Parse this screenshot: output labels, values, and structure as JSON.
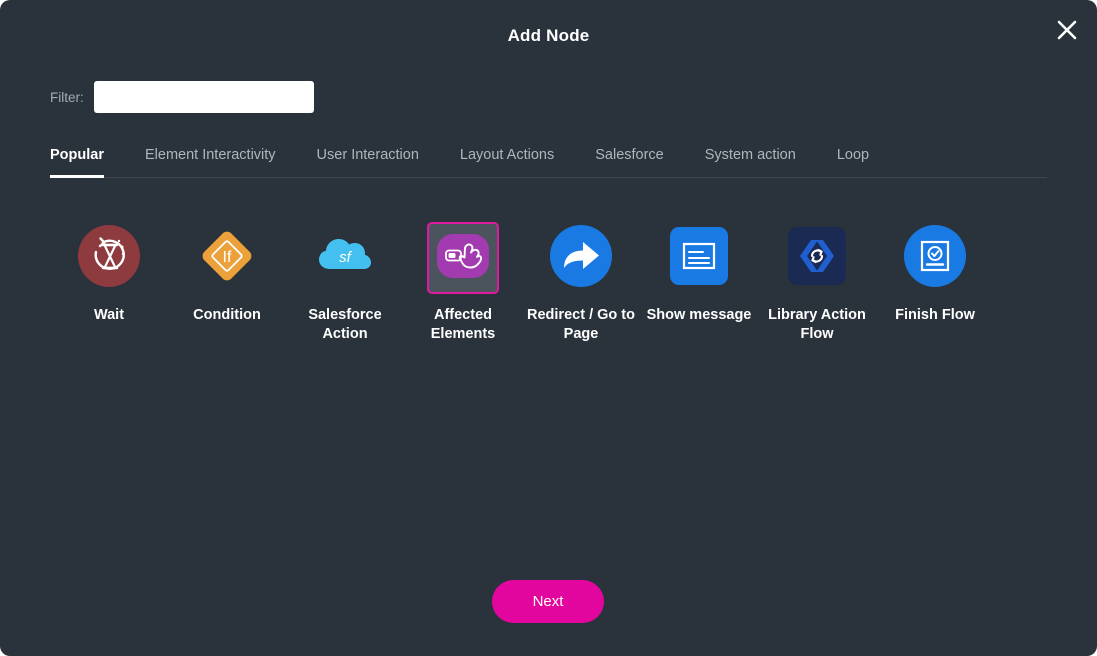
{
  "dialog": {
    "title": "Add Node",
    "close_icon": "close-icon"
  },
  "filter": {
    "label": "Filter:",
    "value": "",
    "placeholder": ""
  },
  "tabs": [
    {
      "label": "Popular",
      "active": true
    },
    {
      "label": "Element Interactivity",
      "active": false
    },
    {
      "label": "User Interaction",
      "active": false
    },
    {
      "label": "Layout Actions",
      "active": false
    },
    {
      "label": "Salesforce",
      "active": false
    },
    {
      "label": "System action",
      "active": false
    },
    {
      "label": "Loop",
      "active": false
    }
  ],
  "nodes": [
    {
      "label": "Wait",
      "icon": "hourglass-timer-icon",
      "selected": false
    },
    {
      "label": "Condition",
      "icon": "if-diamond-icon",
      "selected": false
    },
    {
      "label": "Salesforce Action",
      "icon": "salesforce-cloud-icon",
      "selected": false
    },
    {
      "label": "Affected Elements",
      "icon": "hand-pointer-icon",
      "selected": true
    },
    {
      "label": "Redirect / Go to Page",
      "icon": "redirect-arrow-icon",
      "selected": false
    },
    {
      "label": "Show message",
      "icon": "message-window-icon",
      "selected": false
    },
    {
      "label": "Library Action Flow",
      "icon": "code-refresh-icon",
      "selected": false
    },
    {
      "label": "Finish Flow",
      "icon": "checkmark-document-icon",
      "selected": false
    }
  ],
  "footer": {
    "next_label": "Next"
  },
  "colors": {
    "background": "#2a333b",
    "accent": "#e3069e",
    "selected_border": "#e01aa0",
    "wait": "#8e3b3f",
    "condition": "#eda13b",
    "salesforce": "#43c0ef",
    "affected": "#a33bb0",
    "redirect": "#1a7ae4",
    "show_message": "#1a7ae4",
    "library": "#1b2a52",
    "finish": "#1a7ae4"
  }
}
